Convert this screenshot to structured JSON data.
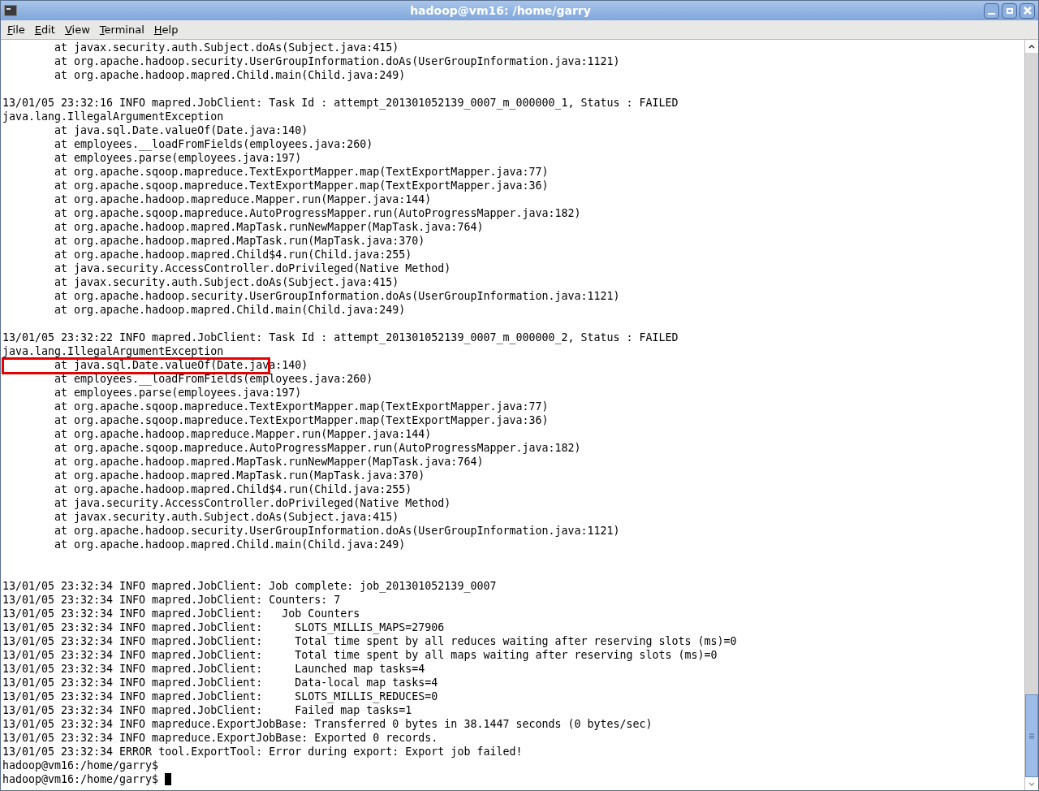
{
  "window": {
    "title": "hadoop@vm16: /home/garry"
  },
  "menu": [
    "File",
    "Edit",
    "View",
    "Terminal",
    "Help"
  ],
  "terminal": {
    "blocks": [
      {
        "lines": [
          {
            "text": "        at javax.security.auth.Subject.doAs(Subject.java:415)"
          },
          {
            "text": "        at org.apache.hadoop.security.UserGroupInformation.doAs(UserGroupInformation.java:1121)"
          },
          {
            "text": "        at org.apache.hadoop.mapred.Child.main(Child.java:249)"
          }
        ]
      },
      {
        "blank_before": true,
        "lines": [
          {
            "text": "13/01/05 23:32:16 INFO mapred.JobClient: Task Id : attempt_201301052139_0007_m_000000_1, Status : FAILED"
          },
          {
            "text": "java.lang.IllegalArgumentException"
          },
          {
            "text": "        at java.sql.Date.valueOf(Date.java:140)"
          },
          {
            "text": "        at employees.__loadFromFields(employees.java:260)"
          },
          {
            "text": "        at employees.parse(employees.java:197)"
          },
          {
            "text": "        at org.apache.sqoop.mapreduce.TextExportMapper.map(TextExportMapper.java:77)"
          },
          {
            "text": "        at org.apache.sqoop.mapreduce.TextExportMapper.map(TextExportMapper.java:36)"
          },
          {
            "text": "        at org.apache.hadoop.mapreduce.Mapper.run(Mapper.java:144)"
          },
          {
            "text": "        at org.apache.sqoop.mapreduce.AutoProgressMapper.run(AutoProgressMapper.java:182)"
          },
          {
            "text": "        at org.apache.hadoop.mapred.MapTask.runNewMapper(MapTask.java:764)"
          },
          {
            "text": "        at org.apache.hadoop.mapred.MapTask.run(MapTask.java:370)"
          },
          {
            "text": "        at org.apache.hadoop.mapred.Child$4.run(Child.java:255)"
          },
          {
            "text": "        at java.security.AccessController.doPrivileged(Native Method)"
          },
          {
            "text": "        at javax.security.auth.Subject.doAs(Subject.java:415)"
          },
          {
            "text": "        at org.apache.hadoop.security.UserGroupInformation.doAs(UserGroupInformation.java:1121)"
          },
          {
            "text": "        at org.apache.hadoop.mapred.Child.main(Child.java:249)"
          }
        ]
      },
      {
        "blank_before": true,
        "lines": [
          {
            "text": "13/01/05 23:32:22 INFO mapred.JobClient: Task Id : attempt_201301052139_0007_m_000000_2, Status : FAILED"
          },
          {
            "text": "java.lang.IllegalArgumentException"
          },
          {
            "text": "        at java.sql.Date.valueOf(Date.java:140)",
            "highlighted": true
          },
          {
            "text": "        at employees.__loadFromFields(employees.java:260)"
          },
          {
            "text": "        at employees.parse(employees.java:197)"
          },
          {
            "text": "        at org.apache.sqoop.mapreduce.TextExportMapper.map(TextExportMapper.java:77)"
          },
          {
            "text": "        at org.apache.sqoop.mapreduce.TextExportMapper.map(TextExportMapper.java:36)"
          },
          {
            "text": "        at org.apache.hadoop.mapreduce.Mapper.run(Mapper.java:144)"
          },
          {
            "text": "        at org.apache.sqoop.mapreduce.AutoProgressMapper.run(AutoProgressMapper.java:182)"
          },
          {
            "text": "        at org.apache.hadoop.mapred.MapTask.runNewMapper(MapTask.java:764)"
          },
          {
            "text": "        at org.apache.hadoop.mapred.MapTask.run(MapTask.java:370)"
          },
          {
            "text": "        at org.apache.hadoop.mapred.Child$4.run(Child.java:255)"
          },
          {
            "text": "        at java.security.AccessController.doPrivileged(Native Method)"
          },
          {
            "text": "        at javax.security.auth.Subject.doAs(Subject.java:415)"
          },
          {
            "text": "        at org.apache.hadoop.security.UserGroupInformation.doAs(UserGroupInformation.java:1121)"
          },
          {
            "text": "        at org.apache.hadoop.mapred.Child.main(Child.java:249)"
          }
        ]
      },
      {
        "blank_before": true,
        "extra_blank_before": true,
        "lines": [
          {
            "text": "13/01/05 23:32:34 INFO mapred.JobClient: Job complete: job_201301052139_0007"
          },
          {
            "text": "13/01/05 23:32:34 INFO mapred.JobClient: Counters: 7"
          },
          {
            "text": "13/01/05 23:32:34 INFO mapred.JobClient:   Job Counters "
          },
          {
            "text": "13/01/05 23:32:34 INFO mapred.JobClient:     SLOTS_MILLIS_MAPS=27906"
          },
          {
            "text": "13/01/05 23:32:34 INFO mapred.JobClient:     Total time spent by all reduces waiting after reserving slots (ms)=0"
          },
          {
            "text": "13/01/05 23:32:34 INFO mapred.JobClient:     Total time spent by all maps waiting after reserving slots (ms)=0"
          },
          {
            "text": "13/01/05 23:32:34 INFO mapred.JobClient:     Launched map tasks=4"
          },
          {
            "text": "13/01/05 23:32:34 INFO mapred.JobClient:     Data-local map tasks=4"
          },
          {
            "text": "13/01/05 23:32:34 INFO mapred.JobClient:     SLOTS_MILLIS_REDUCES=0"
          },
          {
            "text": "13/01/05 23:32:34 INFO mapred.JobClient:     Failed map tasks=1"
          },
          {
            "text": "13/01/05 23:32:34 INFO mapreduce.ExportJobBase: Transferred 0 bytes in 38.1447 seconds (0 bytes/sec)"
          },
          {
            "text": "13/01/05 23:32:34 INFO mapreduce.ExportJobBase: Exported 0 records."
          },
          {
            "text": "13/01/05 23:32:34 ERROR tool.ExportTool: Error during export: Export job failed!"
          },
          {
            "text": "hadoop@vm16:/home/garry$ "
          },
          {
            "text": "hadoop@vm16:/home/garry$ ",
            "cursor": true
          }
        ]
      }
    ]
  }
}
